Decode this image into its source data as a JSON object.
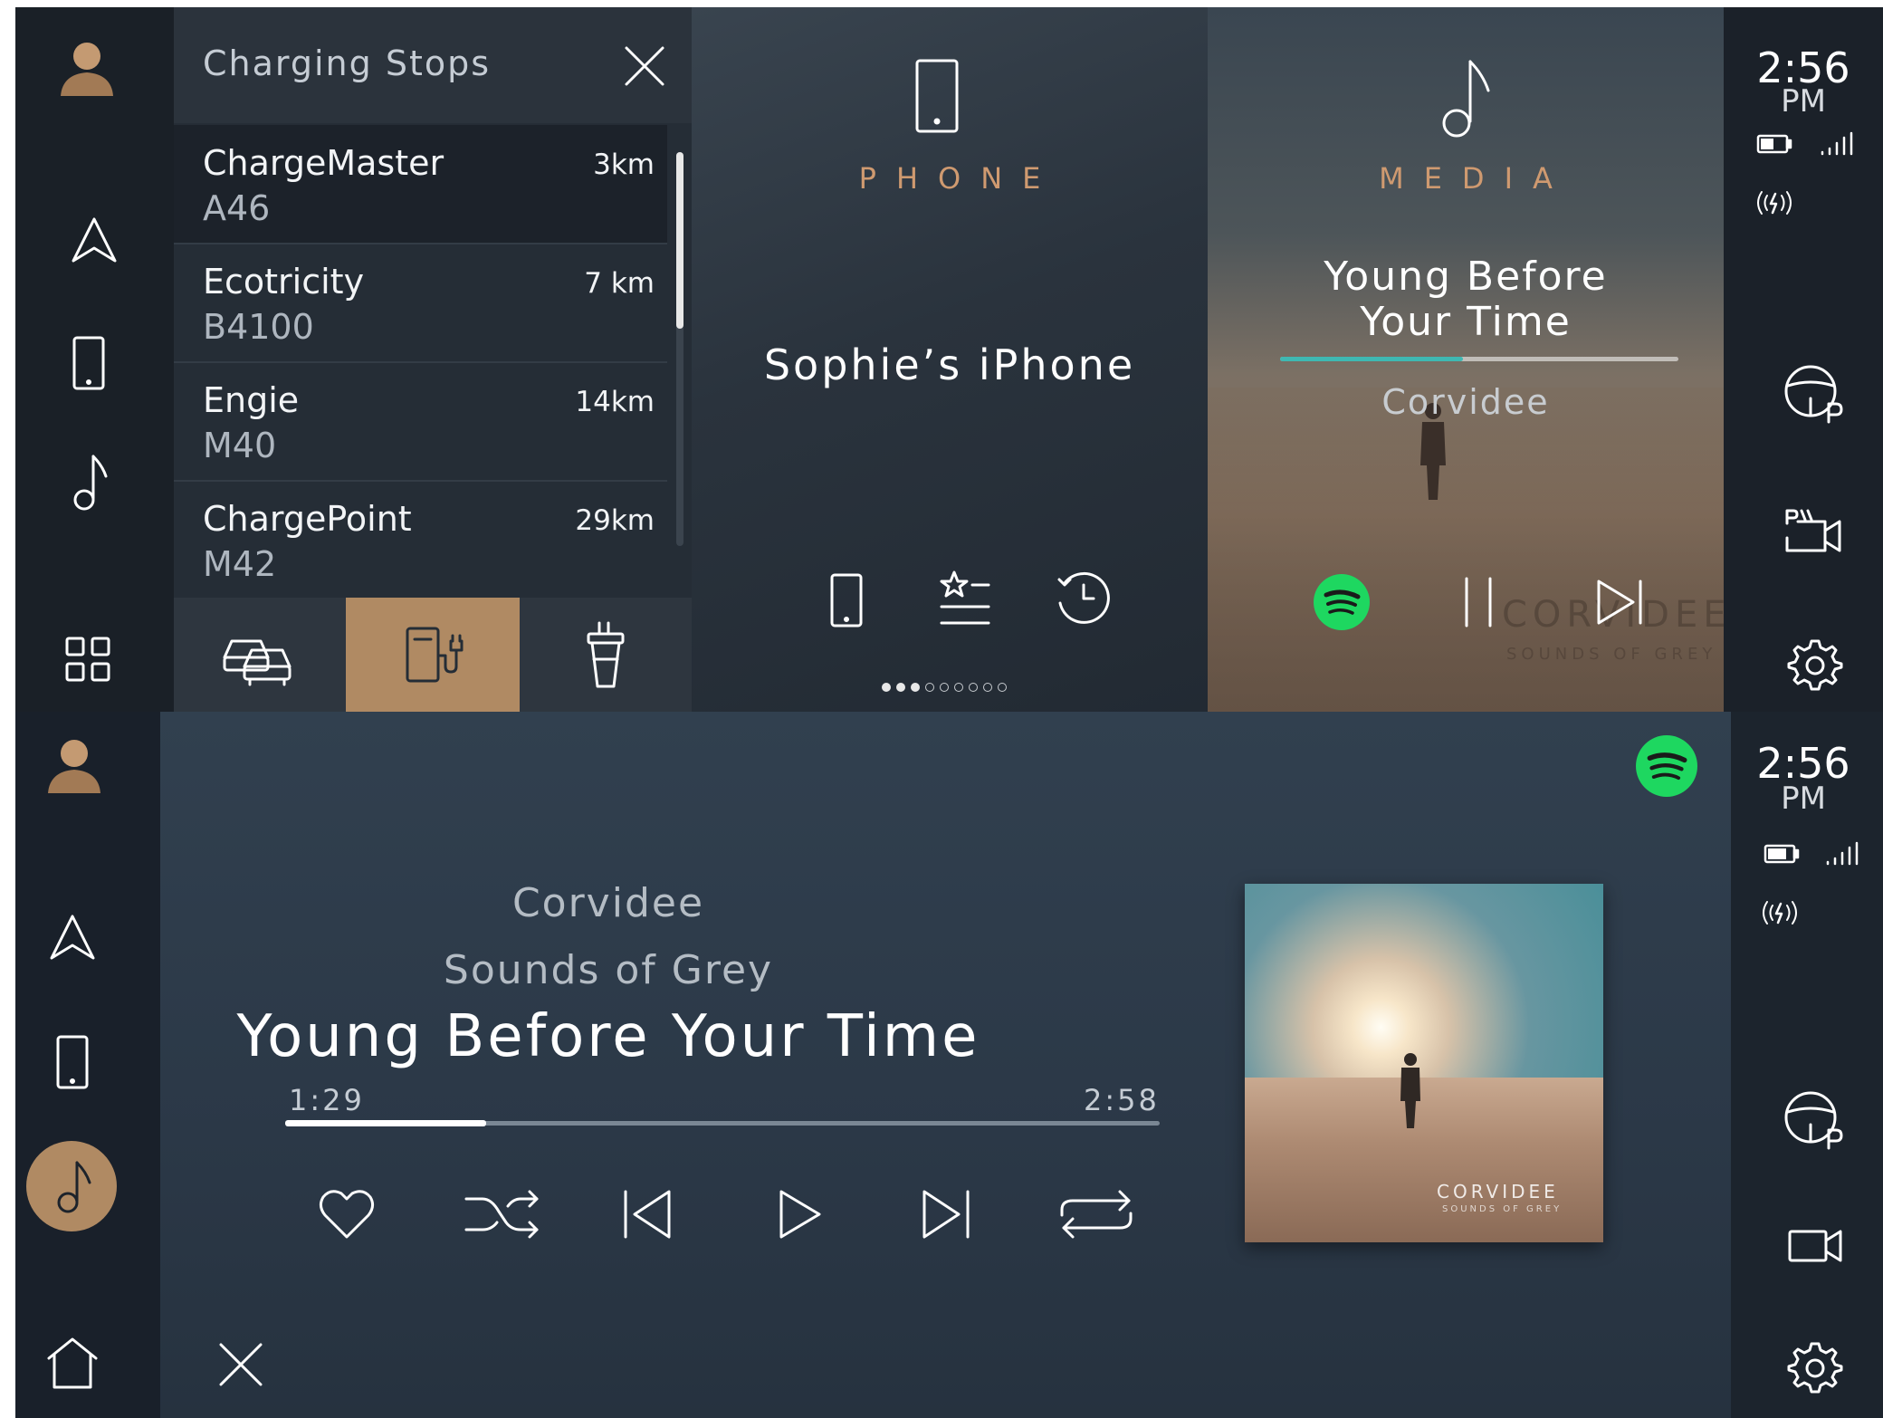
{
  "top": {
    "charging_stops": {
      "title": "Charging Stops",
      "stops": [
        {
          "name": "ChargeMaster",
          "road": "A46",
          "distance": "3km"
        },
        {
          "name": "Ecotricity",
          "road": "B4100",
          "distance": "7 km"
        },
        {
          "name": "Engie",
          "road": "M40",
          "distance": "14km"
        },
        {
          "name": "ChargePoint",
          "road": "M42",
          "distance": "29km"
        }
      ]
    },
    "phone": {
      "label": "PHONE",
      "device_name": "Sophie’s iPhone",
      "page_dots_total": 9,
      "page_dots_active": 3
    },
    "media": {
      "label": "MEDIA",
      "track_title_line1": "Young Before",
      "track_title_line2": "Your Time",
      "artist": "Corvidee",
      "progress": 0.46,
      "watermark_line1": "CORVIDEE",
      "watermark_line2": "SOUNDS OF GREY"
    },
    "status": {
      "time": "2:56",
      "ampm": "PM"
    }
  },
  "bottom": {
    "player": {
      "artist": "Corvidee",
      "album": "Sounds of Grey",
      "track_title": "Young Before Your Time",
      "elapsed": "1:29",
      "duration": "2:58",
      "progress": 0.23
    },
    "album_art": {
      "line1": "CORVIDEE",
      "line2": "SOUNDS OF GREY"
    },
    "status": {
      "time": "2:56",
      "ampm": "PM"
    }
  },
  "colors": {
    "accent_bronze": "#b08a63",
    "spotify_green": "#1ed760",
    "progress_teal": "#3fb8b2",
    "label_copper": "#cf9a70"
  }
}
